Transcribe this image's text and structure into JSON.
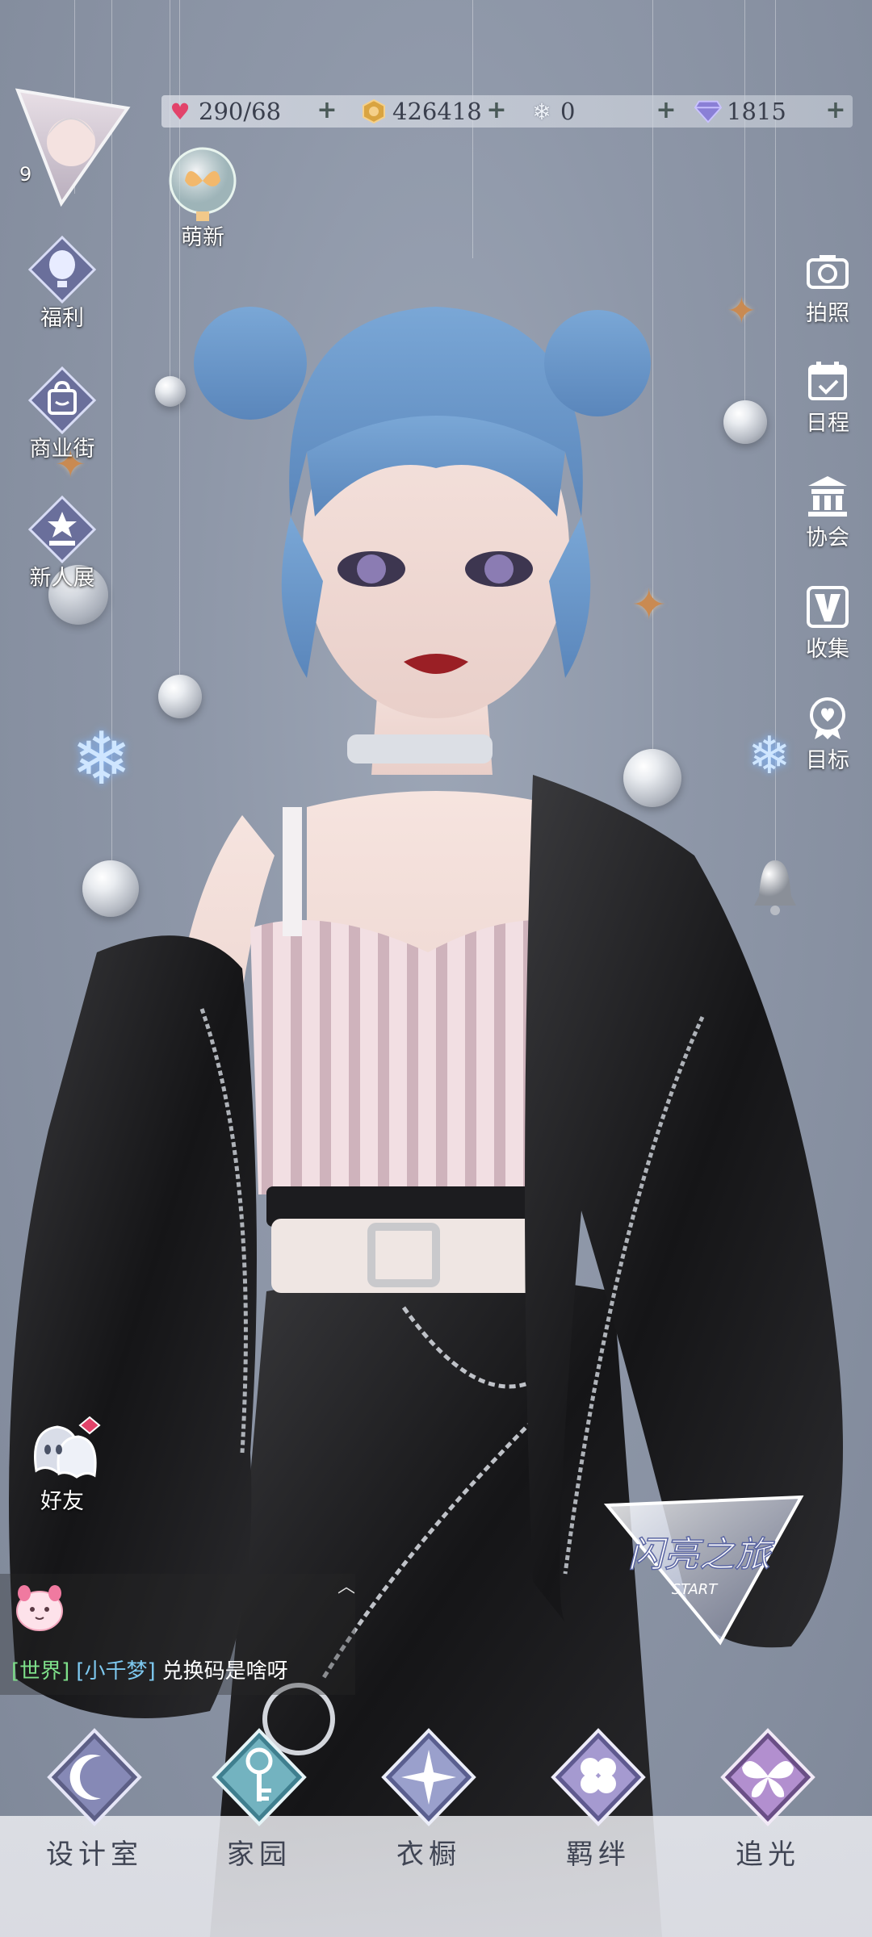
{
  "player": {
    "level": "9"
  },
  "resources": [
    {
      "name": "stamina",
      "icon": "heart-gem-icon",
      "value": "290/68",
      "color": "#e2436a"
    },
    {
      "name": "gold",
      "icon": "gold-coin-icon",
      "value": "426418",
      "color": "#d9a441"
    },
    {
      "name": "crystal",
      "icon": "snow-crystal-icon",
      "value": "0",
      "color": "#cfd8e6"
    },
    {
      "name": "diamond",
      "icon": "diamond-icon",
      "value": "1815",
      "color": "#8a7fd6"
    }
  ],
  "event_bubble": {
    "label": "萌新",
    "icon": "butterfly-bubble-icon"
  },
  "left_menu": [
    {
      "label": "福利",
      "icon": "hot-air-balloon-icon"
    },
    {
      "label": "商业街",
      "icon": "shopping-bag-icon"
    },
    {
      "label": "新人展",
      "icon": "crown-star-icon"
    }
  ],
  "right_menu": [
    {
      "label": "拍照",
      "icon": "camera-icon"
    },
    {
      "label": "日程",
      "icon": "calendar-check-icon"
    },
    {
      "label": "协会",
      "icon": "guild-building-icon"
    },
    {
      "label": "收集",
      "icon": "collection-v-icon"
    },
    {
      "label": "目标",
      "icon": "target-medal-icon"
    }
  ],
  "friends": {
    "label": "好友",
    "icon": "friends-ghost-icon"
  },
  "chat": {
    "channel": "[世界]",
    "user": "[小千梦]",
    "message": "兑换码是啥呀"
  },
  "event_logo": {
    "text_main": "闪亮之旅",
    "text_sub": "START"
  },
  "bottom_nav": [
    {
      "label": "设计室",
      "icon": "moon-gem-icon"
    },
    {
      "label": "家园",
      "icon": "key-gem-icon"
    },
    {
      "label": "衣橱",
      "icon": "sparkle-gem-icon"
    },
    {
      "label": "羁绊",
      "icon": "clover-gem-icon"
    },
    {
      "label": "追光",
      "icon": "butterfly-gem-icon"
    }
  ]
}
